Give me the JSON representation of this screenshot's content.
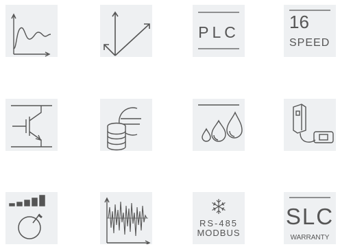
{
  "colors": {
    "tile_bg": "#eef0f2",
    "icon_stroke": "#555555"
  },
  "tiles": [
    {
      "icon": "step-response-graph-icon"
    },
    {
      "icon": "vector-axes-icon"
    },
    {
      "icon": "plc-icon",
      "label": "PLC"
    },
    {
      "icon": "16-speed-icon",
      "number": "16",
      "label": "SPEED"
    },
    {
      "icon": "igbt-transistor-icon"
    },
    {
      "icon": "coins-euro-icon"
    },
    {
      "icon": "water-drops-icon"
    },
    {
      "icon": "keypad-display-icon"
    },
    {
      "icon": "speed-level-knob-icon"
    },
    {
      "icon": "noise-waveform-icon"
    },
    {
      "icon": "rs485-modbus-icon",
      "line1": "RS-485",
      "line2": "MODBUS"
    },
    {
      "icon": "slc-warranty-icon",
      "label": "SLC",
      "sublabel": "WARRANTY"
    }
  ]
}
